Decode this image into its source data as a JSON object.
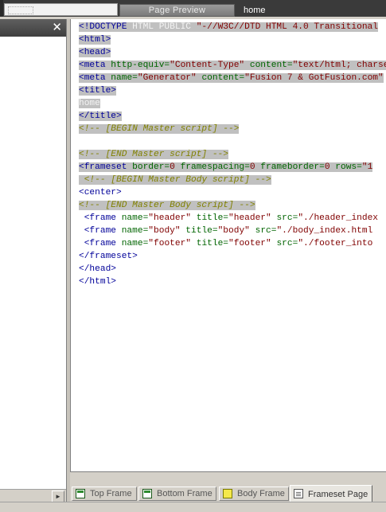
{
  "top_tabs": {
    "page_preview_label": "Page Preview",
    "home_label": "home"
  },
  "left_panel": {
    "close_glyph": "✕",
    "scroll_arrow_glyph": "►"
  },
  "code_lines": [
    [
      {
        "c": "tag",
        "t": "<!DOCTYPE "
      },
      {
        "c": "txtw",
        "t": "HTML PUBLIC "
      },
      {
        "c": "val",
        "t": "\"-//W3C//DTD HTML 4.0 Transitional"
      }
    ],
    [
      {
        "c": "tag",
        "t": "<html>"
      }
    ],
    [
      {
        "c": "tag",
        "t": "<head>"
      }
    ],
    [
      {
        "c": "tag",
        "t": "<meta "
      },
      {
        "c": "attr",
        "t": "http-equiv="
      },
      {
        "c": "val",
        "t": "\"Content-Type\""
      },
      {
        "c": "attr",
        "t": " content="
      },
      {
        "c": "val",
        "t": "\"text/html; charset"
      }
    ],
    [
      {
        "c": "tag",
        "t": "<meta "
      },
      {
        "c": "attr",
        "t": "name="
      },
      {
        "c": "val",
        "t": "\"Generator\""
      },
      {
        "c": "attr",
        "t": " content="
      },
      {
        "c": "val",
        "t": "\"Fusion 7 & GotFusion.com\""
      }
    ],
    [
      {
        "c": "tag",
        "t": "<title>"
      }
    ],
    [
      {
        "c": "txtw",
        "t": "home"
      }
    ],
    [
      {
        "c": "tag",
        "t": "</title>"
      }
    ],
    [
      {
        "c": "com",
        "t": "<!-- [BEGIN Master script] -->"
      }
    ],
    [
      {
        "c": "txt",
        "t": ""
      }
    ],
    [
      {
        "c": "com",
        "t": "<!-- [END Master script] -->"
      }
    ],
    [
      {
        "c": "tag",
        "t": "<frameset "
      },
      {
        "c": "attr",
        "t": "border="
      },
      {
        "c": "val",
        "t": "0"
      },
      {
        "c": "attr",
        "t": " framespacing="
      },
      {
        "c": "val",
        "t": "0"
      },
      {
        "c": "attr",
        "t": " frameborder="
      },
      {
        "c": "val",
        "t": "0"
      },
      {
        "c": "attr",
        "t": " rows="
      },
      {
        "c": "val",
        "t": "\"1"
      }
    ],
    [
      {
        "c": "com",
        "t": " <!-- [BEGIN Master Body script] -->"
      }
    ],
    [
      {
        "c": "tag",
        "t": "<center>"
      }
    ],
    [
      {
        "c": "com",
        "t": "<!-- [END Master Body script] -->"
      }
    ],
    [
      {
        "c": "tag",
        "t": " <frame "
      },
      {
        "c": "attr",
        "t": "name="
      },
      {
        "c": "val",
        "t": "\"header\""
      },
      {
        "c": "attr",
        "t": " title="
      },
      {
        "c": "val",
        "t": "\"header\""
      },
      {
        "c": "attr",
        "t": " src="
      },
      {
        "c": "val",
        "t": "\"./header_index"
      }
    ],
    [
      {
        "c": "tag",
        "t": " <frame "
      },
      {
        "c": "attr",
        "t": "name="
      },
      {
        "c": "val",
        "t": "\"body\""
      },
      {
        "c": "attr",
        "t": " title="
      },
      {
        "c": "val",
        "t": "\"body\""
      },
      {
        "c": "attr",
        "t": " src="
      },
      {
        "c": "val",
        "t": "\"./body_index.html"
      }
    ],
    [
      {
        "c": "tag",
        "t": " <frame "
      },
      {
        "c": "attr",
        "t": "name="
      },
      {
        "c": "val",
        "t": "\"footer\""
      },
      {
        "c": "attr",
        "t": " title="
      },
      {
        "c": "val",
        "t": "\"footer\""
      },
      {
        "c": "attr",
        "t": " src="
      },
      {
        "c": "val",
        "t": "\"./footer_into"
      }
    ],
    [
      {
        "c": "tag",
        "t": "</frameset>"
      }
    ],
    [
      {
        "c": "tag",
        "t": "</head>"
      }
    ],
    [
      {
        "c": "tag",
        "t": "</html>"
      }
    ]
  ],
  "highlighted_lines": [
    0,
    1,
    2,
    3,
    4,
    5,
    6,
    7,
    8,
    10,
    11,
    12,
    14
  ],
  "bottom_tabs": [
    {
      "label": "Top Frame",
      "icon": "top-frame-icon"
    },
    {
      "label": "Bottom Frame",
      "icon": "bottom-frame-icon"
    },
    {
      "label": "Body Frame",
      "icon": "body-frame-icon"
    },
    {
      "label": "Frameset Page",
      "icon": "frameset-page-icon",
      "active": true
    }
  ]
}
